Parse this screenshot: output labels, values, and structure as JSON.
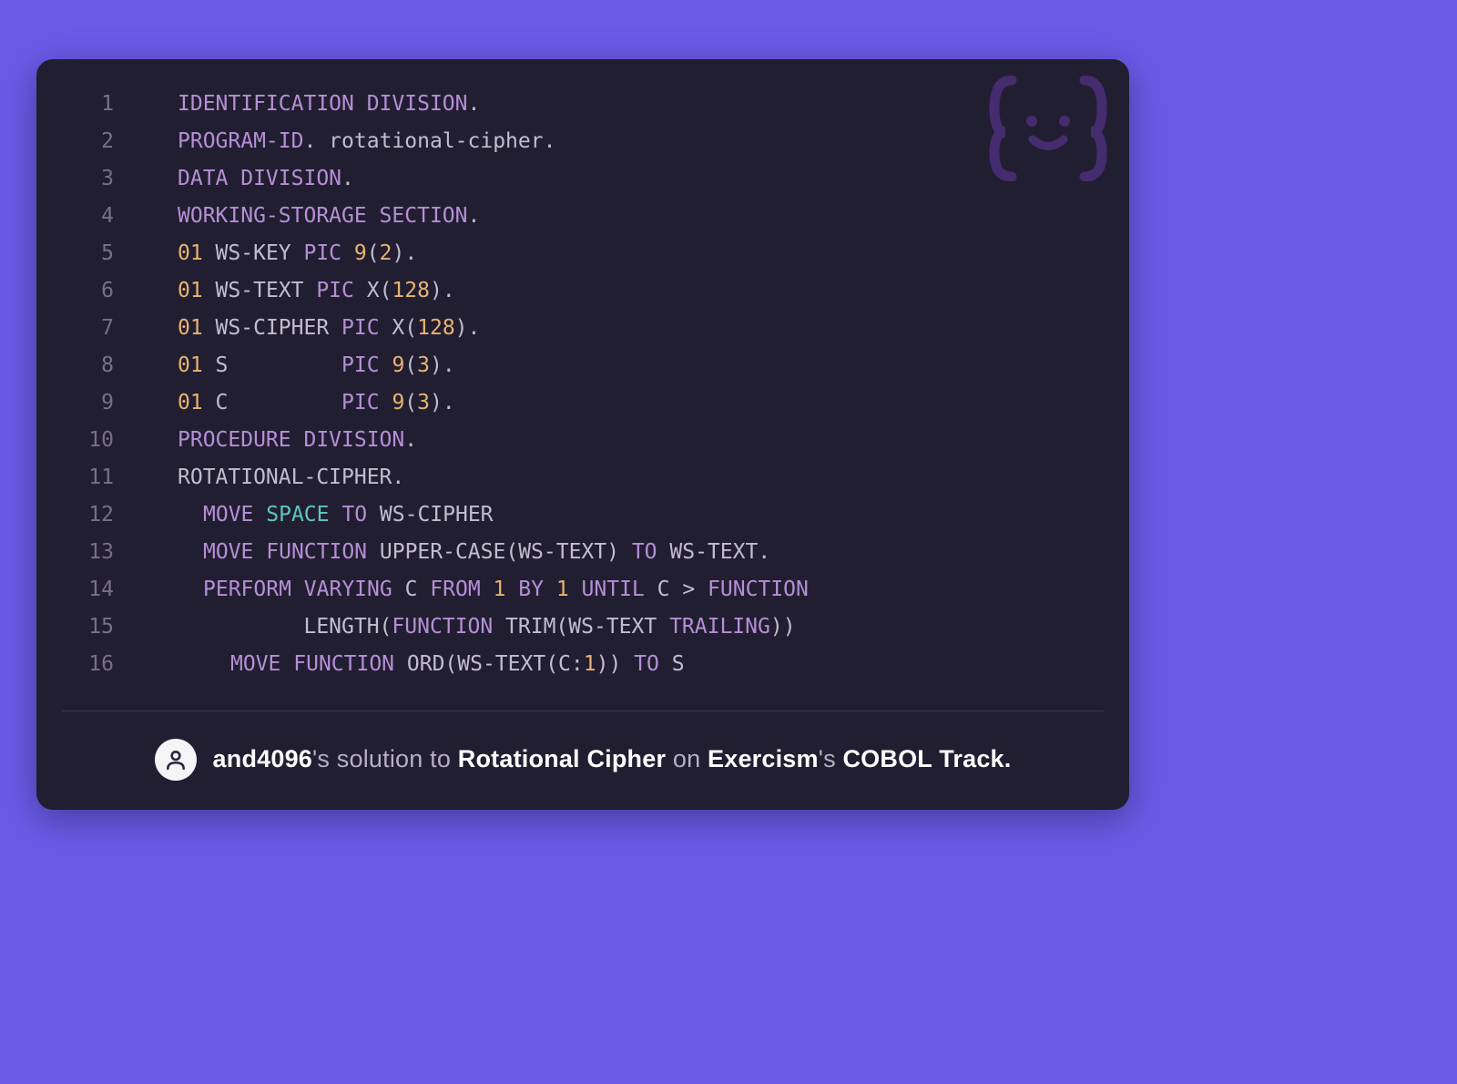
{
  "code": {
    "lines": [
      {
        "n": "1",
        "tokens": [
          {
            "t": "IDENTIFICATION DIVISION",
            "c": "tok-section"
          },
          {
            "t": ".",
            "c": "tok-punc"
          }
        ]
      },
      {
        "n": "2",
        "tokens": [
          {
            "t": "PROGRAM-ID",
            "c": "tok-section"
          },
          {
            "t": ". rotational-cipher.",
            "c": "tok-id"
          }
        ]
      },
      {
        "n": "3",
        "tokens": [
          {
            "t": "DATA DIVISION",
            "c": "tok-section"
          },
          {
            "t": ".",
            "c": "tok-punc"
          }
        ]
      },
      {
        "n": "4",
        "tokens": [
          {
            "t": "WORKING-STORAGE SECTION",
            "c": "tok-section"
          },
          {
            "t": ".",
            "c": "tok-punc"
          }
        ]
      },
      {
        "n": "5",
        "tokens": [
          {
            "t": "01",
            "c": "tok-num"
          },
          {
            "t": " WS-KEY ",
            "c": "tok-id"
          },
          {
            "t": "PIC",
            "c": "tok-key"
          },
          {
            "t": " ",
            "c": "tok-id"
          },
          {
            "t": "9",
            "c": "tok-num"
          },
          {
            "t": "(",
            "c": "tok-punc"
          },
          {
            "t": "2",
            "c": "tok-num"
          },
          {
            "t": ").",
            "c": "tok-punc"
          }
        ]
      },
      {
        "n": "6",
        "tokens": [
          {
            "t": "01",
            "c": "tok-num"
          },
          {
            "t": " WS-TEXT ",
            "c": "tok-id"
          },
          {
            "t": "PIC",
            "c": "tok-key"
          },
          {
            "t": " X(",
            "c": "tok-id"
          },
          {
            "t": "128",
            "c": "tok-num"
          },
          {
            "t": ").",
            "c": "tok-punc"
          }
        ]
      },
      {
        "n": "7",
        "tokens": [
          {
            "t": "01",
            "c": "tok-num"
          },
          {
            "t": " WS-CIPHER ",
            "c": "tok-id"
          },
          {
            "t": "PIC",
            "c": "tok-key"
          },
          {
            "t": " X(",
            "c": "tok-id"
          },
          {
            "t": "128",
            "c": "tok-num"
          },
          {
            "t": ").",
            "c": "tok-punc"
          }
        ]
      },
      {
        "n": "8",
        "tokens": [
          {
            "t": "01",
            "c": "tok-num"
          },
          {
            "t": " S         ",
            "c": "tok-id"
          },
          {
            "t": "PIC",
            "c": "tok-key"
          },
          {
            "t": " ",
            "c": "tok-id"
          },
          {
            "t": "9",
            "c": "tok-num"
          },
          {
            "t": "(",
            "c": "tok-punc"
          },
          {
            "t": "3",
            "c": "tok-num"
          },
          {
            "t": ").",
            "c": "tok-punc"
          }
        ]
      },
      {
        "n": "9",
        "tokens": [
          {
            "t": "01",
            "c": "tok-num"
          },
          {
            "t": " C         ",
            "c": "tok-id"
          },
          {
            "t": "PIC",
            "c": "tok-key"
          },
          {
            "t": " ",
            "c": "tok-id"
          },
          {
            "t": "9",
            "c": "tok-num"
          },
          {
            "t": "(",
            "c": "tok-punc"
          },
          {
            "t": "3",
            "c": "tok-num"
          },
          {
            "t": ").",
            "c": "tok-punc"
          }
        ]
      },
      {
        "n": "10",
        "tokens": [
          {
            "t": "PROCEDURE DIVISION",
            "c": "tok-section"
          },
          {
            "t": ".",
            "c": "tok-punc"
          }
        ]
      },
      {
        "n": "11",
        "tokens": [
          {
            "t": "ROTATIONAL-CIPHER.",
            "c": "tok-id"
          }
        ]
      },
      {
        "n": "12",
        "indent": "indent2",
        "tokens": [
          {
            "t": "MOVE",
            "c": "tok-key"
          },
          {
            "t": " ",
            "c": "tok-id"
          },
          {
            "t": "SPACE",
            "c": "tok-lit"
          },
          {
            "t": " ",
            "c": "tok-id"
          },
          {
            "t": "TO",
            "c": "tok-key"
          },
          {
            "t": " WS-CIPHER",
            "c": "tok-id"
          }
        ]
      },
      {
        "n": "13",
        "indent": "indent2",
        "tokens": [
          {
            "t": "MOVE",
            "c": "tok-key"
          },
          {
            "t": " ",
            "c": "tok-id"
          },
          {
            "t": "FUNCTION",
            "c": "tok-key"
          },
          {
            "t": " UPPER-CASE(WS-TEXT) ",
            "c": "tok-id"
          },
          {
            "t": "TO",
            "c": "tok-key"
          },
          {
            "t": " WS-TEXT.",
            "c": "tok-id"
          }
        ]
      },
      {
        "n": "14",
        "indent": "indent2",
        "tokens": [
          {
            "t": "PERFORM",
            "c": "tok-key"
          },
          {
            "t": " ",
            "c": "tok-id"
          },
          {
            "t": "VARYING",
            "c": "tok-key"
          },
          {
            "t": " C ",
            "c": "tok-id"
          },
          {
            "t": "FROM",
            "c": "tok-key"
          },
          {
            "t": " ",
            "c": "tok-id"
          },
          {
            "t": "1",
            "c": "tok-num"
          },
          {
            "t": " ",
            "c": "tok-id"
          },
          {
            "t": "BY",
            "c": "tok-key"
          },
          {
            "t": " ",
            "c": "tok-id"
          },
          {
            "t": "1",
            "c": "tok-num"
          },
          {
            "t": " ",
            "c": "tok-id"
          },
          {
            "t": "UNTIL",
            "c": "tok-key"
          },
          {
            "t": " C > ",
            "c": "tok-id"
          },
          {
            "t": "FUNCTION",
            "c": "tok-key"
          }
        ]
      },
      {
        "n": "15",
        "indent": "indent-long",
        "tokens": [
          {
            "t": "          LENGTH(",
            "c": "tok-id"
          },
          {
            "t": "FUNCTION",
            "c": "tok-key"
          },
          {
            "t": " TRIM(WS-TEXT ",
            "c": "tok-id"
          },
          {
            "t": "TRAILING",
            "c": "tok-key"
          },
          {
            "t": "))",
            "c": "tok-id"
          }
        ]
      },
      {
        "n": "16",
        "indent": "indent4",
        "tokens": [
          {
            "t": "MOVE",
            "c": "tok-key"
          },
          {
            "t": " ",
            "c": "tok-id"
          },
          {
            "t": "FUNCTION",
            "c": "tok-key"
          },
          {
            "t": " ORD(WS-TEXT(C:",
            "c": "tok-id"
          },
          {
            "t": "1",
            "c": "tok-num"
          },
          {
            "t": ")) ",
            "c": "tok-id"
          },
          {
            "t": "TO",
            "c": "tok-key"
          },
          {
            "t": " S",
            "c": "tok-id"
          }
        ]
      }
    ]
  },
  "footer": {
    "user": "and4096",
    "p1": "'s ",
    "p2": "solution to ",
    "exercise": "Rotational Cipher",
    "p3": " on ",
    "platform": "Exercism",
    "p4": "'s ",
    "track": "COBOL Track."
  }
}
